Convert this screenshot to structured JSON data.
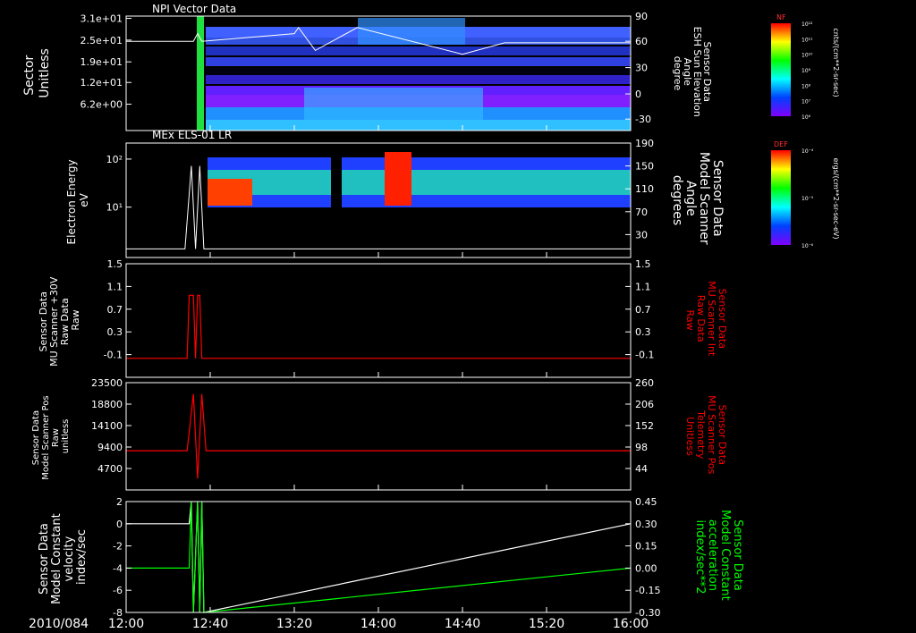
{
  "date_label": "2010/084",
  "time_ticks": [
    "12:00",
    "12:40",
    "13:20",
    "14:00",
    "14:40",
    "15:20",
    "16:00"
  ],
  "colors": {
    "background": "#000000",
    "axes": "#ffffff",
    "red": "#ff0000",
    "green": "#00ff00"
  },
  "panels": [
    {
      "title": "NPI Vector Data",
      "left_label": [
        "Sector",
        "Unitless"
      ],
      "left_ticks": [
        "3.1e+01",
        "2.5e+01",
        "1.9e+01",
        "1.2e+01",
        "6.2e+00"
      ],
      "right_ticks": [
        "90",
        "60",
        "30",
        "0",
        "-30"
      ],
      "right_label": [
        "Sensor Data",
        "ESH Sun Elevation",
        "Angle",
        "degree"
      ],
      "right_label_color": "#ffffff",
      "colorbar_label": "NF",
      "colorbar_units": "cnts/(cm**2-sr-sec)",
      "colorbar_ticks": [
        "10¹²",
        "10¹¹",
        "10¹⁰",
        "10⁹",
        "10⁸",
        "10⁷",
        "10⁶"
      ]
    },
    {
      "title": "MEx ELS-01 LR",
      "left_label": [
        "Electron Energy",
        "eV"
      ],
      "left_ticks": [
        "10²",
        "10¹"
      ],
      "right_ticks": [
        "190",
        "150",
        "110",
        "70",
        "30"
      ],
      "right_label": [
        "Sensor Data",
        "Model Scanner",
        "Angle",
        "degrees"
      ],
      "right_label_color": "#ffffff",
      "colorbar_label": "DEF",
      "colorbar_units": "ergs/(cm**2-sr-sec-eV)",
      "colorbar_ticks": [
        "10⁻⁴",
        "10⁻⁵",
        "10⁻⁶"
      ]
    },
    {
      "left_label": [
        "Sensor Data",
        "MU Scanner +30V",
        "Raw Data",
        "Raw"
      ],
      "left_ticks": [
        "1.5",
        "1.1",
        "0.7",
        "0.3",
        "-0.1"
      ],
      "right_ticks": [
        "1.5",
        "1.1",
        "0.7",
        "0.3",
        "-0.1"
      ],
      "right_label": [
        "Sensor Data",
        "MU Scanner Int",
        "Raw Data",
        "Raw"
      ],
      "right_label_color": "#ff0000"
    },
    {
      "left_label": [
        "Sensor Data",
        "Model Scanner Pos",
        "Raw",
        "unitless"
      ],
      "left_ticks": [
        "23500",
        "18800",
        "14100",
        "9400",
        "4700"
      ],
      "right_ticks": [
        "260",
        "206",
        "152",
        "98",
        "44"
      ],
      "right_label": [
        "Sensor Data",
        "MU Scanner Pos",
        "Telemetry",
        "Unitless"
      ],
      "right_label_color": "#ff0000"
    },
    {
      "left_label": [
        "Sensor Data",
        "Model Constant",
        "velocity",
        "index/sec"
      ],
      "left_ticks": [
        "2",
        "0",
        "-2",
        "-4",
        "-6",
        "-8"
      ],
      "right_ticks": [
        "0.45",
        "0.30",
        "0.15",
        "0.00",
        "-0.15",
        "-0.30"
      ],
      "right_label": [
        "Sensor Data",
        "Model Constant",
        "acceleration",
        "index/sec**2"
      ],
      "right_label_color": "#00ff00"
    }
  ],
  "chart_data": [
    {
      "type": "heatmap",
      "title": "NPI Vector Data",
      "x_range": [
        "12:00",
        "16:00"
      ],
      "y_axis": "Sector (Unitless)",
      "y_ticks": [
        31,
        25,
        19,
        12,
        6.2
      ],
      "y2_axis": "ESH Sun Elevation Angle (degree)",
      "y2_ticks": [
        90,
        60,
        30,
        0,
        -30
      ],
      "overlay_series": {
        "name": "ESH Sun Elevation Angle",
        "x": [
          "12:00",
          "12:32",
          "12:34",
          "12:36",
          "13:20",
          "13:22",
          "13:30",
          "13:50",
          "14:40",
          "15:00",
          "16:00"
        ],
        "y": [
          62,
          62,
          72,
          62,
          72,
          80,
          50,
          80,
          45,
          60,
          60
        ]
      }
    },
    {
      "type": "heatmap",
      "title": "MEx ELS-01 LR",
      "x_range": [
        "12:00",
        "16:00"
      ],
      "y_axis": "Electron Energy (eV)",
      "y_scale": "log",
      "y2_axis": "Model Scanner Angle (degrees)",
      "y2_ticks": [
        190,
        150,
        110,
        70,
        30
      ],
      "overlay_series": {
        "name": "Model Scanner Angle",
        "x": [
          "12:00",
          "12:28",
          "12:31",
          "12:33",
          "12:35",
          "12:37",
          "16:00"
        ],
        "y": [
          15,
          15,
          160,
          15,
          160,
          15,
          15
        ]
      }
    },
    {
      "type": "line",
      "x_range": [
        "12:00",
        "16:00"
      ],
      "ylim": [
        -0.3,
        1.5
      ],
      "y2lim": [
        -0.3,
        1.5
      ],
      "series": [
        {
          "name": "MU Scanner Int Raw Data",
          "color": "#ff0000",
          "x": [
            "12:00",
            "12:29",
            "12:30",
            "12:32",
            "12:33",
            "12:34",
            "12:35",
            "12:36",
            "16:00"
          ],
          "y": [
            0.0,
            0.0,
            1.0,
            1.0,
            0.0,
            1.0,
            1.0,
            0.0,
            0.0
          ]
        }
      ]
    },
    {
      "type": "line",
      "x_range": [
        "12:00",
        "16:00"
      ],
      "ylim": [
        0,
        23500
      ],
      "y2lim": [
        0,
        260
      ],
      "series": [
        {
          "name": "MU Scanner Pos Telemetry",
          "color": "#ff0000",
          "x": [
            "12:00",
            "12:29",
            "12:32",
            "12:34",
            "12:36",
            "12:38",
            "16:00"
          ],
          "y": [
            8600,
            8600,
            21000,
            2500,
            21000,
            8600,
            8600
          ]
        }
      ]
    },
    {
      "type": "line",
      "x_range": [
        "12:00",
        "16:00"
      ],
      "ylim": [
        -8,
        2
      ],
      "y2lim": [
        -0.3,
        0.45
      ],
      "series": [
        {
          "name": "Model Constant velocity",
          "color": "#ffffff",
          "x": [
            "12:00",
            "12:30",
            "12:31",
            "12:32",
            "12:34",
            "12:35",
            "12:36",
            "12:37",
            "16:00"
          ],
          "y": [
            0,
            0,
            2,
            -8,
            2,
            -8,
            2,
            -8,
            0
          ]
        },
        {
          "name": "Model Constant acceleration",
          "color": "#00ff00",
          "x": [
            "12:00",
            "12:30",
            "12:31",
            "12:32",
            "12:34",
            "12:35",
            "12:36",
            "12:37",
            "16:00"
          ],
          "y": [
            0.0,
            0.0,
            0.45,
            -0.3,
            0.45,
            -0.3,
            0.45,
            -0.3,
            0.0
          ]
        }
      ]
    }
  ]
}
